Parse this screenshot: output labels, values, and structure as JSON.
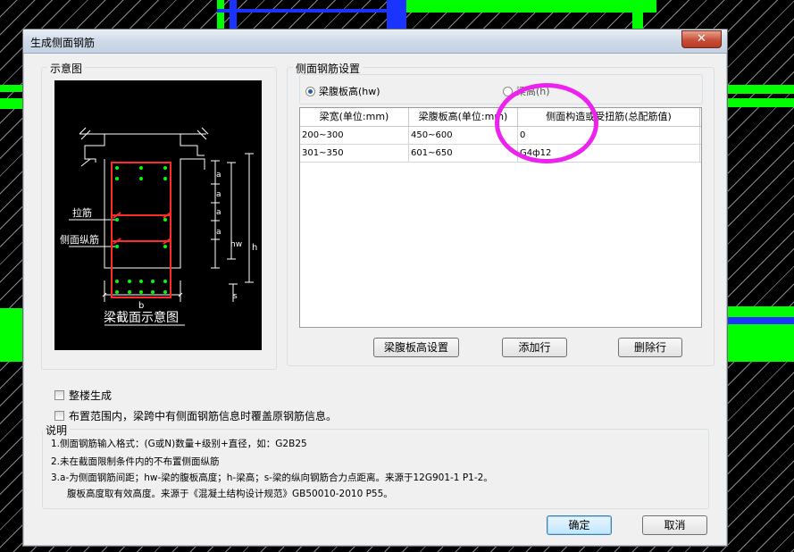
{
  "dialog": {
    "title": "生成侧面钢筋",
    "close_glyph": "✕"
  },
  "diagram_group": {
    "label": "示意图",
    "caption": "梁截面示意图",
    "labels": {
      "tie_bar": "拉筋",
      "side_bar": "侧面纵筋",
      "a": "a",
      "hw": "hw",
      "h": "h",
      "s": "s",
      "b": "b"
    }
  },
  "settings_group": {
    "label": "侧面钢筋设置",
    "radio_web_height": "梁腹板高(hw)",
    "radio_beam_height": "梁高(h)",
    "selected": "radio_web_height"
  },
  "table": {
    "columns": [
      "梁宽(单位:mm)",
      "梁腹板高(单位:mm)",
      "侧面构造或受扭筋(总配筋值)"
    ],
    "rows": [
      [
        "200~300",
        "450~600",
        "0"
      ],
      [
        "301~350",
        "601~650",
        "G4ф12"
      ]
    ]
  },
  "buttons": {
    "web_height_setting": "梁腹板高设置",
    "add_row": "添加行",
    "delete_row": "删除行",
    "ok": "确定",
    "cancel": "取消"
  },
  "checkboxes": {
    "whole_building": "整楼生成",
    "overwrite": "布置范围内，梁跨中有侧面钢筋信息时覆盖原钢筋信息。"
  },
  "notes": {
    "title": "说明",
    "line1": "1.侧面钢筋输入格式：(G或N)数量+级别+直径，如：G2B25",
    "line2": "2.未在截面限制条件内的不布置侧面纵筋",
    "line3": "3.a-为侧面钢筋间距；hw-梁的腹板高度；h-梁高；s-梁的纵向钢筋合力点距离。来源于12G901-1 P1-2。",
    "line4": "腹板高度取有效高度。来源于《混凝土结构设计规范》GB50010-2010 P55。"
  },
  "colors": {
    "cad_green": "#00ff00",
    "cad_blue": "#1b33ff",
    "annotation_magenta": "#ee22ee",
    "rebar_red": "#ff2a2a"
  }
}
